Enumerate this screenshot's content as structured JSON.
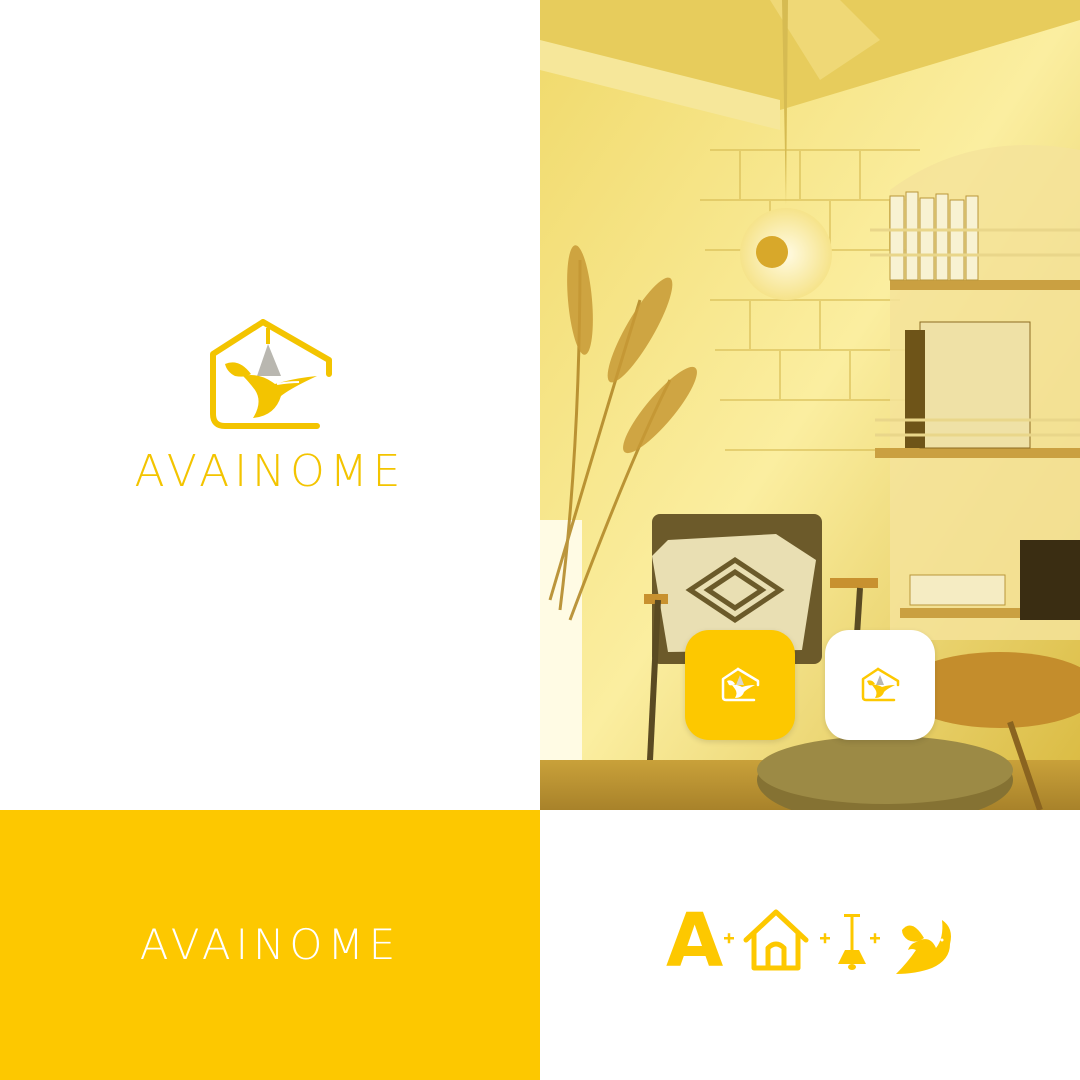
{
  "brand": {
    "name": "AVAINOME",
    "colors": {
      "yellow": "#fdc800",
      "white": "#ffffff",
      "lamp_gray": "#b9b7b0"
    }
  },
  "logo_panel": {
    "wordmark": "AVAINOME",
    "mark_icon": "house-hummingbird-lamp-icon"
  },
  "photo_panel": {
    "scene": "photo-of-cozy-interior",
    "icons": [
      {
        "variant": "yellow",
        "icon": "house-hummingbird-lamp-icon"
      },
      {
        "variant": "white",
        "icon": "house-hummingbird-lamp-icon"
      }
    ]
  },
  "yellow_band": {
    "wordmark": "AVAINOME"
  },
  "concept": {
    "letter": "A",
    "parts": [
      "house-icon",
      "pendant-lamp-icon",
      "bird-icon"
    ],
    "operator": "+"
  }
}
